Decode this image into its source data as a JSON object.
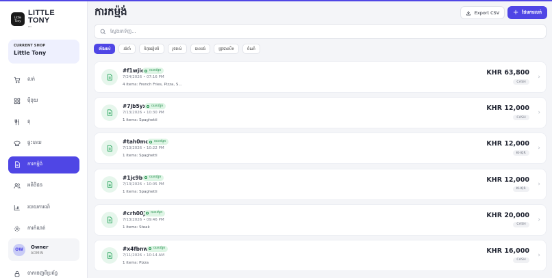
{
  "brand": {
    "name_line1": "LITTLE",
    "name_line2": "TONY",
    "sub": "•••",
    "logo_text": "Little Tony"
  },
  "shop": {
    "caption": "CURRENT SHOP",
    "name": "Little Tony"
  },
  "nav": [
    {
      "label": "លក់",
      "icon": "cart-icon",
      "active": false
    },
    {
      "label": "ម៉ឺនុយ",
      "icon": "grid-icon",
      "active": false
    },
    {
      "label": "តុ",
      "icon": "utensils-icon",
      "active": false
    },
    {
      "label": "ផ្ទះបាយ",
      "icon": "chef-hat-icon",
      "active": false
    },
    {
      "label": "ការកម្ម៉ង់",
      "icon": "receipt-icon",
      "active": true
    },
    {
      "label": "អតិថិជន",
      "icon": "users-icon",
      "active": false
    },
    {
      "label": "របាយការណ៍",
      "icon": "chart-icon",
      "active": false
    },
    {
      "label": "ការកំណត់",
      "icon": "gear-icon",
      "active": false
    }
  ],
  "user": {
    "initials": "OW",
    "name": "Owner",
    "role": "ADMIN"
  },
  "logout_label": "ចាកចេញពីប្រព័ន្ធ",
  "header": {
    "title": "ការកម្ម៉ង់",
    "export_label": "Export CSV",
    "new_label": "ថែមការលក់"
  },
  "search": {
    "placeholder": "ស្វែងរកទិញ...",
    "value": ""
  },
  "filters": [
    {
      "label": "ទាំងអស់",
      "active": true
    },
    {
      "label": "រង់ចាំ",
      "active": false
    },
    {
      "label": "កំពុងរៀបចំ",
      "active": false
    },
    {
      "label": "រួចរាល់",
      "active": false
    },
    {
      "label": "បានបង់",
      "active": false
    },
    {
      "label": "ត្រូវបានបិទ",
      "active": false
    },
    {
      "label": "ចំណាំ",
      "active": false
    }
  ],
  "orders": [
    {
      "id": "#f1wjie",
      "status": "បានបង់រួច",
      "time": "7/24/2026 • 07:16 PM",
      "items": "4 items: French Fries, Pizza, S...",
      "amount": "KHR 63,800",
      "payment": "CASH"
    },
    {
      "id": "#7jb5yx",
      "status": "បានបង់រួច",
      "time": "7/13/2026 • 10:30 PM",
      "items": "1 items: Spaghetti",
      "amount": "KHR 12,000",
      "payment": "CASH"
    },
    {
      "id": "#tah0mc",
      "status": "បានបង់រួច",
      "time": "7/13/2026 • 10:22 PM",
      "items": "1 items: Spaghetti",
      "amount": "KHR 12,000",
      "payment": "KHQR"
    },
    {
      "id": "#1jc9br",
      "status": "បានបង់រួច",
      "time": "7/13/2026 • 10:05 PM",
      "items": "1 items: Spaghetti",
      "amount": "KHR 12,000",
      "payment": "KHQR"
    },
    {
      "id": "#crh00j",
      "status": "បានបង់រួច",
      "time": "7/13/2026 • 09:46 PM",
      "items": "1 items: Steak",
      "amount": "KHR 20,000",
      "payment": "CASH"
    },
    {
      "id": "#x4fbnw",
      "status": "បានបង់រួច",
      "time": "7/11/2026 • 10:14 AM",
      "items": "1 items: Pizza",
      "amount": "KHR 16,000",
      "payment": "CASH"
    }
  ],
  "colors": {
    "accent": "#4f46e5",
    "paid_badge_bg": "#def5e5",
    "paid_badge_text": "#1b8a46",
    "doc_icon": "#22a358"
  }
}
